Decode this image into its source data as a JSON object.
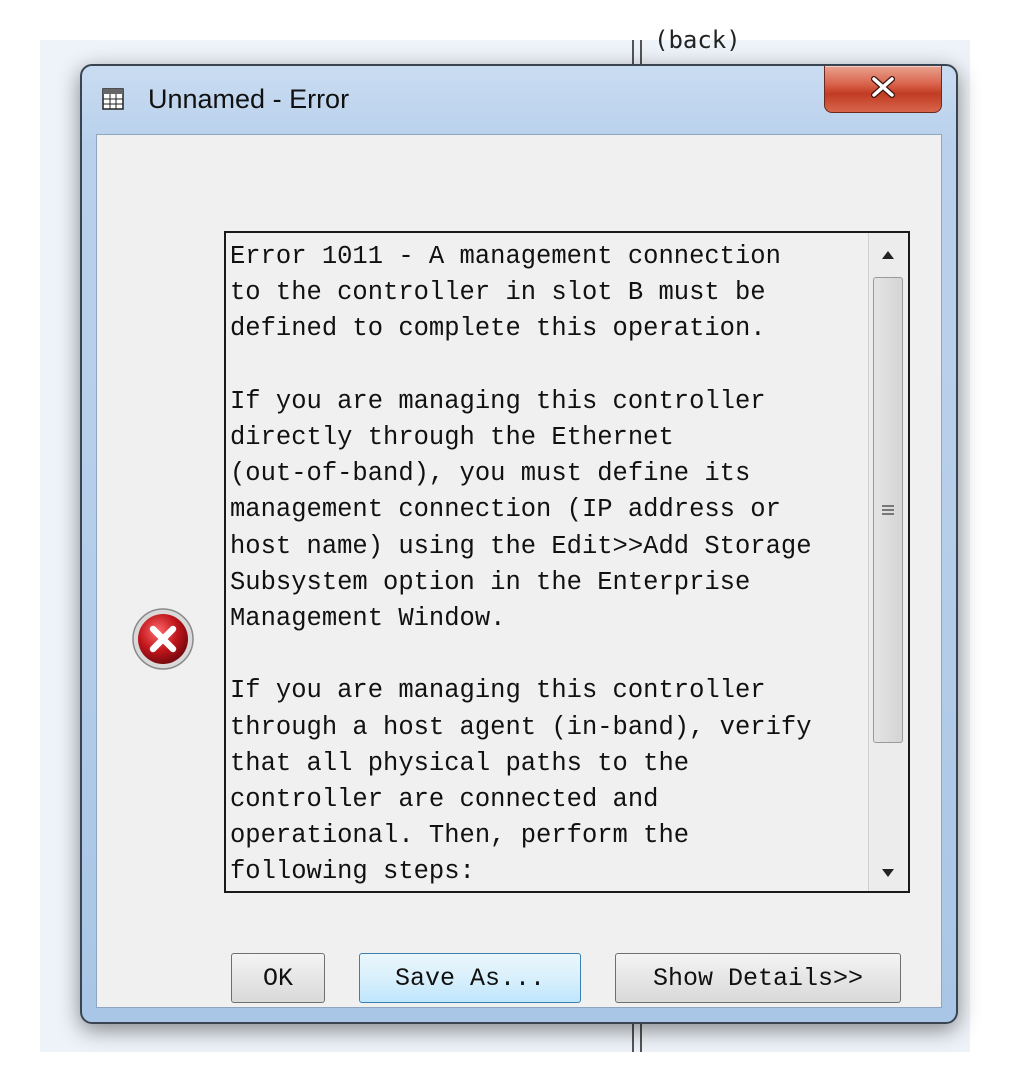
{
  "background": {
    "partial_text": "(back)"
  },
  "window": {
    "title": "Unnamed - Error"
  },
  "message": {
    "lines": [
      "Error 1011 - A management connection",
      "to the controller in slot B must be",
      "defined to complete this operation.",
      "",
      "If you are managing this controller",
      "directly through the Ethernet",
      "(out-of-band), you must define its",
      "management connection (IP address or",
      "host name) using the Edit>>Add Storage",
      "Subsystem option in the Enterprise",
      "Management Window.",
      "",
      "If you are managing this controller",
      "through a host agent (in-band), verify",
      "that all physical paths to the",
      "controller are connected and",
      "operational. Then, perform the",
      "following steps:"
    ]
  },
  "buttons": {
    "ok": "OK",
    "save_as": "Save As...",
    "show_details": "Show Details>>"
  },
  "icons": {
    "app": "table-icon",
    "close": "close-icon",
    "error": "error-icon"
  },
  "colors": {
    "close_button": "#c13b23",
    "error_icon": "#c0151b",
    "titlebar": "#b9d1ec"
  }
}
